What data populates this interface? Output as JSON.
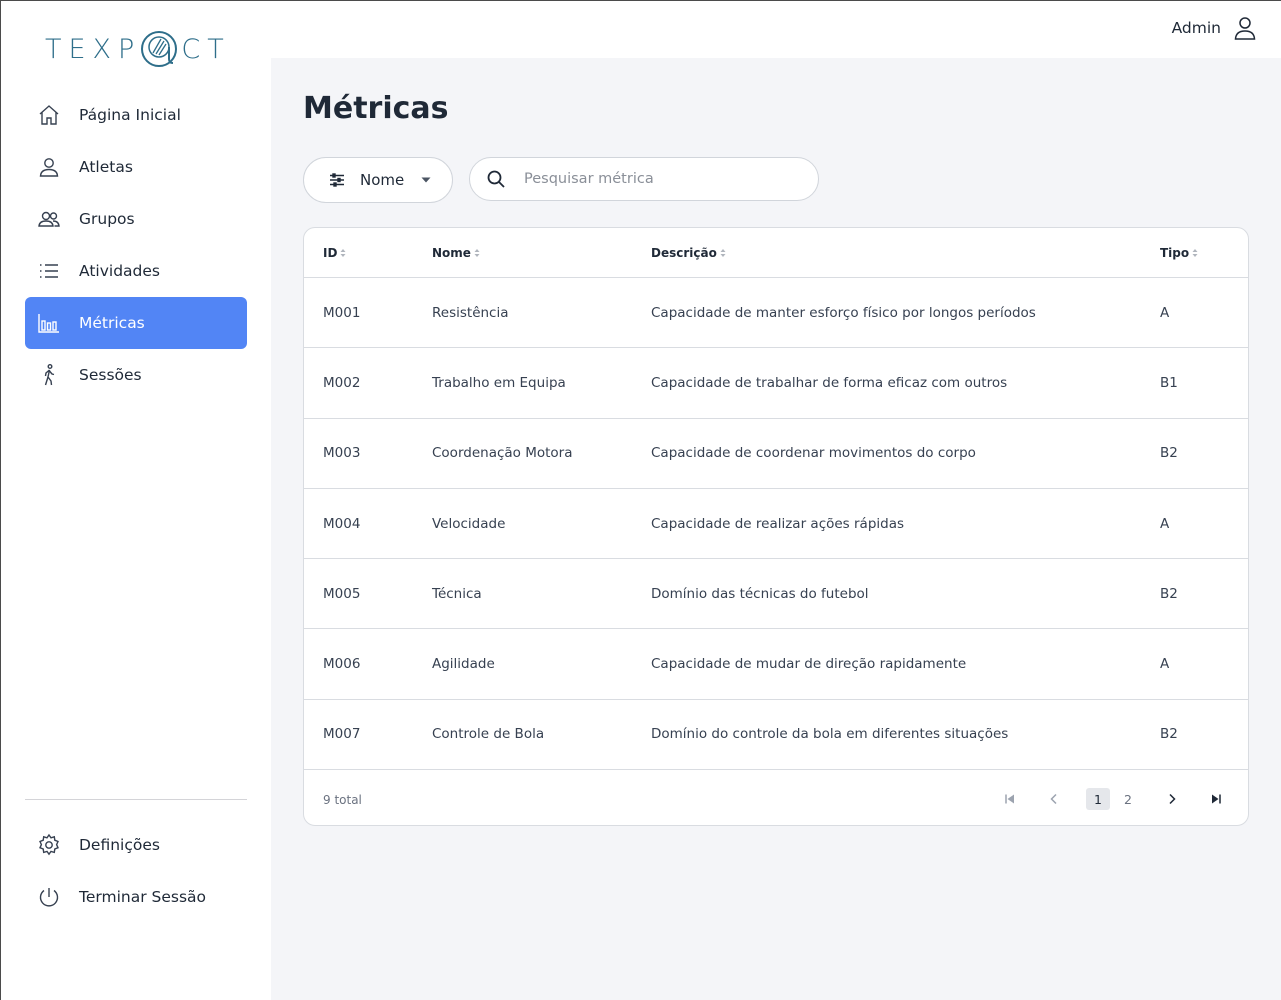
{
  "brand": {
    "logo_text_left": "TEXP",
    "logo_text_right": "CT"
  },
  "sidebar": {
    "items": [
      {
        "label": "Página Inicial",
        "icon": "home-icon",
        "active": false
      },
      {
        "label": "Atletas",
        "icon": "user-icon",
        "active": false
      },
      {
        "label": "Grupos",
        "icon": "users-icon",
        "active": false
      },
      {
        "label": "Atividades",
        "icon": "list-icon",
        "active": false
      },
      {
        "label": "Métricas",
        "icon": "bar-chart-icon",
        "active": true
      },
      {
        "label": "Sessões",
        "icon": "walking-icon",
        "active": false
      }
    ],
    "bottom": [
      {
        "label": "Definições",
        "icon": "gear-icon"
      },
      {
        "label": "Terminar Sessão",
        "icon": "power-icon"
      }
    ]
  },
  "header": {
    "user_label": "Admin",
    "user_icon": "user-icon"
  },
  "main": {
    "title": "Métricas",
    "filter": {
      "selected": "Nome",
      "icon": "sliders-icon"
    },
    "search": {
      "placeholder": "Pesquisar métrica",
      "value": ""
    }
  },
  "table": {
    "columns": [
      "ID",
      "Nome",
      "Descrição",
      "Tipo"
    ],
    "rows": [
      [
        "M001",
        "Resistência",
        "Capacidade de manter esforço físico por longos períodos",
        "A"
      ],
      [
        "M002",
        "Trabalho em Equipa",
        "Capacidade de trabalhar de forma eficaz com outros",
        "B1"
      ],
      [
        "M003",
        "Coordenação Motora",
        "Capacidade de coordenar movimentos do corpo",
        "B2"
      ],
      [
        "M004",
        "Velocidade",
        "Capacidade de realizar ações rápidas",
        "A"
      ],
      [
        "M005",
        "Técnica",
        "Domínio das técnicas do futebol",
        "B2"
      ],
      [
        "M006",
        "Agilidade",
        "Capacidade de mudar de direção rapidamente",
        "A"
      ],
      [
        "M007",
        "Controle de Bola",
        "Domínio do controle da bola em diferentes situações",
        "B2"
      ]
    ],
    "total": "9 total",
    "pages": [
      "1",
      "2"
    ],
    "current_page": "1"
  },
  "colors": {
    "accent": "#5285f5",
    "logo": "#2e6e8a",
    "background": "#f4f5f8"
  }
}
